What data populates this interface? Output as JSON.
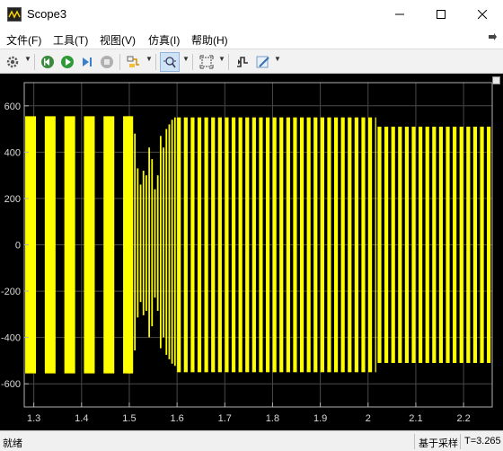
{
  "window": {
    "title": "Scope3"
  },
  "menu": [
    {
      "label": "文件(F)"
    },
    {
      "label": "工具(T)"
    },
    {
      "label": "视图(V)"
    },
    {
      "label": "仿真(I)"
    },
    {
      "label": "帮助(H)"
    }
  ],
  "toolbar": {
    "buttons": [
      {
        "name": "settings-gear-icon"
      },
      {
        "name": "step-back-icon"
      },
      {
        "name": "run-icon"
      },
      {
        "name": "step-forward-icon"
      },
      {
        "name": "stop-icon"
      },
      {
        "name": "highlight-signal-icon"
      },
      {
        "name": "zoom-x-icon",
        "active": true
      },
      {
        "name": "autoscale-icon"
      },
      {
        "name": "triggers-icon"
      },
      {
        "name": "style-icon"
      }
    ]
  },
  "status": {
    "ready": "就绪",
    "mode": "基于采样",
    "time": "T=3.265"
  },
  "colors": {
    "plot_bg": "#000000",
    "axes": "#b0b0b0",
    "grid": "#4a4a4a",
    "signal": "#ffff00"
  },
  "chart_data": {
    "type": "line",
    "xlim": [
      1.28,
      2.26
    ],
    "ylim": [
      -700,
      700
    ],
    "grid": true,
    "xticks": [
      1.3,
      1.4,
      1.5,
      1.6,
      1.7,
      1.8,
      1.9,
      2.0,
      2.1,
      2.2
    ],
    "xtick_labels": [
      "1.3",
      "1.4",
      "1.5",
      "1.6",
      "1.7",
      "1.8",
      "1.9",
      "2",
      "2.1",
      "2.2"
    ],
    "yticks": [
      600,
      400,
      200,
      0,
      -200,
      -400,
      -600
    ],
    "ytick_labels": [
      "600",
      "400",
      "200",
      "0",
      "-200",
      "-400",
      "-600"
    ],
    "series": [
      {
        "description_segments": [
          {
            "x_start": 1.28,
            "x_end": 1.51,
            "amplitude": 555,
            "cycle_period": 0.041
          },
          {
            "x_start": 1.51,
            "x_end": 1.6,
            "amplitude_transient": true
          },
          {
            "x_start": 1.6,
            "x_end": 2.02,
            "amplitude": 550,
            "cycle_period": 0.0143
          },
          {
            "x_start": 2.02,
            "x_end": 2.26,
            "amplitude": 510,
            "cycle_period": 0.0143
          }
        ]
      }
    ]
  }
}
